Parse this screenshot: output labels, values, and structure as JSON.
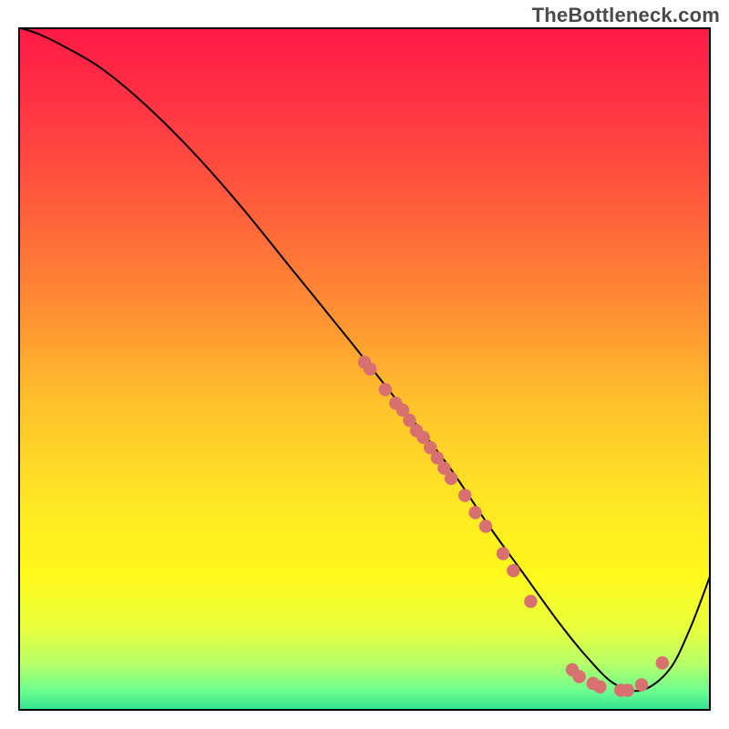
{
  "watermark": "TheBottleneck.com",
  "gradient_stops": [
    {
      "offset": 0.0,
      "color": "#ff1a46"
    },
    {
      "offset": 0.1,
      "color": "#ff3044"
    },
    {
      "offset": 0.25,
      "color": "#ff5a3c"
    },
    {
      "offset": 0.4,
      "color": "#ff8a34"
    },
    {
      "offset": 0.55,
      "color": "#ffc22c"
    },
    {
      "offset": 0.7,
      "color": "#ffe824"
    },
    {
      "offset": 0.8,
      "color": "#fff81c"
    },
    {
      "offset": 0.88,
      "color": "#e8ff3c"
    },
    {
      "offset": 0.93,
      "color": "#b8ff68"
    },
    {
      "offset": 0.97,
      "color": "#70ff90"
    },
    {
      "offset": 1.0,
      "color": "#30e090"
    }
  ],
  "chart_data": {
    "type": "line",
    "title": "",
    "xlabel": "",
    "ylabel": "",
    "xlim": [
      0,
      100
    ],
    "ylim": [
      0,
      100
    ],
    "series": [
      {
        "name": "curve",
        "x": [
          0,
          3,
          7,
          12,
          18,
          25,
          32,
          40,
          48,
          55,
          62,
          68,
          73,
          78,
          82,
          86,
          90,
          94,
          97,
          100
        ],
        "y": [
          100,
          99,
          97,
          94,
          89,
          82,
          74,
          64,
          54,
          45,
          36,
          27,
          20,
          13,
          8,
          4,
          3,
          6,
          12,
          20
        ]
      }
    ],
    "markers": [
      {
        "x": 50,
        "y": 51
      },
      {
        "x": 50.8,
        "y": 50
      },
      {
        "x": 53,
        "y": 47
      },
      {
        "x": 54.5,
        "y": 45
      },
      {
        "x": 55.5,
        "y": 44
      },
      {
        "x": 56.5,
        "y": 42.5
      },
      {
        "x": 57.5,
        "y": 41
      },
      {
        "x": 58.5,
        "y": 40
      },
      {
        "x": 59.5,
        "y": 38.5
      },
      {
        "x": 60.5,
        "y": 37
      },
      {
        "x": 61.5,
        "y": 35.5
      },
      {
        "x": 62.5,
        "y": 34
      },
      {
        "x": 64.5,
        "y": 31.5
      },
      {
        "x": 66,
        "y": 29
      },
      {
        "x": 67.5,
        "y": 27
      },
      {
        "x": 70,
        "y": 23
      },
      {
        "x": 71.5,
        "y": 20.5
      },
      {
        "x": 74,
        "y": 16
      },
      {
        "x": 80,
        "y": 6
      },
      {
        "x": 81,
        "y": 5
      },
      {
        "x": 83,
        "y": 4
      },
      {
        "x": 84,
        "y": 3.5
      },
      {
        "x": 87,
        "y": 3
      },
      {
        "x": 88,
        "y": 3
      },
      {
        "x": 90,
        "y": 3.8
      },
      {
        "x": 93,
        "y": 7
      }
    ],
    "marker_color": "#d87070",
    "line_color": "#000000"
  }
}
